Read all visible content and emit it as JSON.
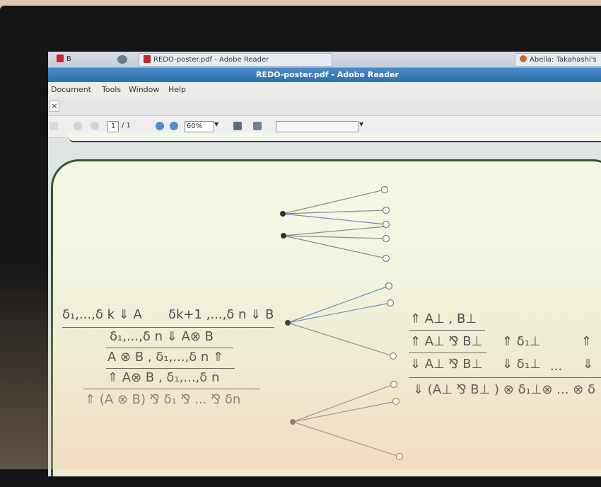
{
  "taskbar": {
    "item1": "B",
    "item2_title": "REDO-poster.pdf - Adobe Reader",
    "item3_title": "Abella: Takahashi's"
  },
  "window": {
    "title": "REDO-poster.pdf - Adobe Reader"
  },
  "menu": {
    "items": [
      "Document",
      "Tools",
      "Window",
      "Help"
    ]
  },
  "toolbar": {
    "current_page": "1",
    "page_total": "/ 1",
    "zoom": "60%"
  },
  "proof": {
    "line1_a": "δ₁,...,δ k ⇓ A",
    "line1_b": "δk+1 ,...,δ n ⇓ B",
    "line2": "δ₁,...,δ n ⇓ A⊗ B",
    "line3": "A ⊗ B , δ₁,...,δ n ⇑",
    "line4": "⇑ A⊗ B , δ₁,...,δ n",
    "line5": "⇑ (A ⊗ B) ⅋ δ₁ ⅋ ... ⅋ δn",
    "right1": "⇑ A⊥ , B⊥",
    "right2": "⇑ A⊥ ⅋ B⊥",
    "right2b": "⇑ δ₁⊥",
    "right2c": "⇑",
    "right3": "⇓ A⊥ ⅋ B⊥",
    "right3b": "⇓ δ₁⊥",
    "right3c": "...",
    "right3d": "⇓",
    "right4": "⇓ (A⊥ ⅋ B⊥ ) ⊗ δ₁⊥⊗ ... ⊗ δ"
  }
}
